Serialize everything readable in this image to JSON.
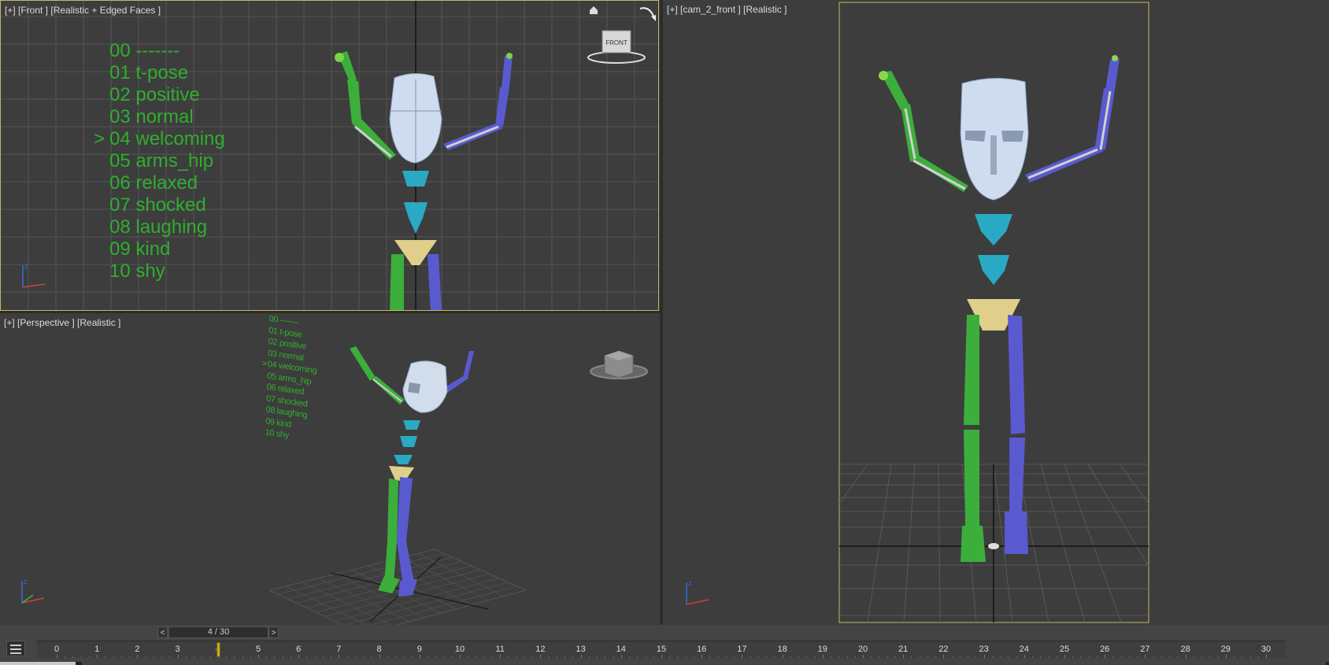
{
  "viewports": {
    "front": {
      "label": "[+] [Front ] [Realistic + Edged Faces ]",
      "viewcube_label": "FRONT"
    },
    "perspective": {
      "label": "[+] [Perspective ] [Realistic ]"
    },
    "camera": {
      "label": "[+] [cam_2_front ] [Realistic ]"
    }
  },
  "pose_list": {
    "selected_marker": ">",
    "items": [
      "00 -------",
      "01 t-pose",
      "02 positive",
      "03 normal",
      "04 welcoming",
      "05 arms_hip",
      "06 relaxed",
      "07 shocked",
      "08 laughing",
      "09 kind",
      "10 shy"
    ],
    "selected_index": 4
  },
  "timeline": {
    "frame_display": "4 / 30",
    "prev_label": "<",
    "next_label": ">",
    "current_frame": 4,
    "ticks": [
      "0",
      "1",
      "2",
      "3",
      "4",
      "5",
      "6",
      "7",
      "8",
      "9",
      "10",
      "11",
      "12",
      "13",
      "14",
      "15",
      "16",
      "17",
      "18",
      "19",
      "20",
      "21",
      "22",
      "23",
      "24",
      "25",
      "26",
      "27",
      "28",
      "29",
      "30"
    ]
  },
  "colors": {
    "viewport_bg": "#3d3d3d",
    "active_border": "#c8b860",
    "pose_text": "#2fae2f",
    "left_limb": "#3cae3c",
    "right_limb": "#5a5ad0",
    "spine": "#2aa9c4",
    "pelvis": "#e0cf8a",
    "head": "#cfdcef"
  }
}
